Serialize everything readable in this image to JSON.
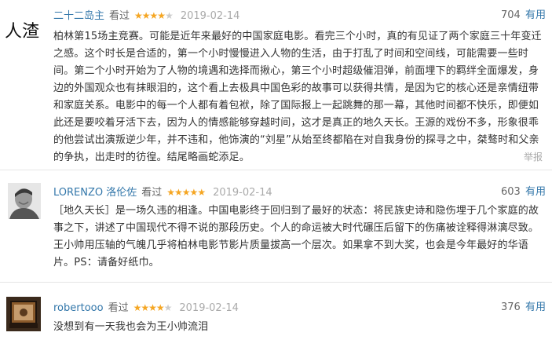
{
  "reviews": [
    {
      "user": "二十二岛主",
      "action": "看过",
      "rating": 4,
      "date": "2019-02-14",
      "votes": "704",
      "useful_label": "有用",
      "avatar_text": "人渣",
      "content": "柏林第15场主竞赛。可能是近年来最好的中国家庭电影。看完三个小时，真的有见证了两个家庭三十年变迁之感。这个时长是合适的，第一个小时慢慢进入人物的生活，由于打乱了时间和空间线，可能需要一些时间。第二个小时开始为了人物的境遇和选择而揪心，第三个小时超级催泪弹，前面埋下的羁绊全面爆发，身边的外国观众也有抹眼泪的，这个看上去极具中国色彩的故事可以获得共情，是因为它的核心还是亲情纽带和家庭关系。电影中的每一个人都有着包袱，除了国际报上一起跳舞的那一幕，其他时间都不快乐，即便如此还是要咬着牙活下去，因为人的情感能够穿越时间，这才是真正的地久天长。王源的戏份不多，形象很乖的他尝试出演叛逆少年，并不违和，他饰演的“刘星”从始至终都陷在对自我身份的探寻之中，桀骜时和父亲的争执，出走时的彷徨。结尾略画蛇添足。",
      "report": "举报"
    },
    {
      "user": "LORENZO 洛伦佐",
      "action": "看过",
      "rating": 5,
      "date": "2019-02-14",
      "votes": "603",
      "useful_label": "有用",
      "content": "［地久天长］是一场久违的相逢。中国电影终于回归到了最好的状态：将民族史诗和隐伤埋于几个家庭的故事之下，讲述了中国现代不得不说的那段历史。个人的命运被大时代碾压后留下的伤痛被诠释得淋漓尽致。王小帅用压轴的气魄几乎将柏林电影节影片质量拔高一个层次。如果拿不到大奖，也会是今年最好的华语片。PS：请备好纸巾。"
    },
    {
      "user": "robertooo",
      "action": "看过",
      "rating": 4,
      "date": "2019-02-14",
      "votes": "376",
      "useful_label": "有用",
      "content": "没想到有一天我也会为王小帅流泪"
    }
  ]
}
